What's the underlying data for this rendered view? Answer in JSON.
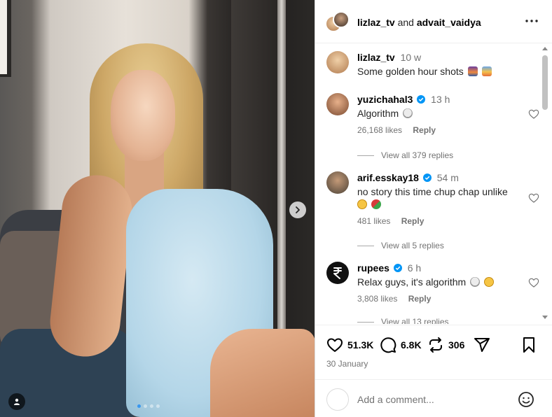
{
  "header": {
    "user_one": "lizlaz_tv",
    "connector": "and",
    "user_two": "advait_vaidya",
    "more_icon": "more-horizontal-icon"
  },
  "caption": {
    "user": "lizlaz_tv",
    "time": "10 w",
    "text": "Some golden hour shots",
    "emojis": [
      "sunset-emoji",
      "sunrise-emoji"
    ]
  },
  "comments": [
    {
      "user": "yuzichahal3",
      "verified": true,
      "time": "13 h",
      "text": "Algorithm",
      "emojis": [
        "skull-emoji"
      ],
      "likes": "26,168 likes",
      "reply_label": "Reply",
      "view_replies": "View all 379 replies"
    },
    {
      "user": "arif.esskay18",
      "verified": true,
      "time": "54 m",
      "text": "no story this time chup chap unlike",
      "emojis": [
        "crying-face-emoji",
        "ping-pong-emoji"
      ],
      "likes": "481 likes",
      "reply_label": "Reply",
      "view_replies": "View all 5 replies"
    },
    {
      "user": "rupees",
      "verified": true,
      "time": "6 h",
      "text": "Relax guys, it's algorithm",
      "emojis": [
        "skull-emoji",
        "crying-face-emoji"
      ],
      "likes": "3,808 likes",
      "reply_label": "Reply",
      "view_replies": "View all 13 replies"
    }
  ],
  "actions": {
    "likes": "51.3K",
    "comments": "6.8K",
    "reposts": "306"
  },
  "post_date": "30 January",
  "comment_box": {
    "placeholder": "Add a comment..."
  },
  "colors": {
    "verified": "#0095f6",
    "active_dot": "#3897f0",
    "muted_text": "#737373"
  }
}
